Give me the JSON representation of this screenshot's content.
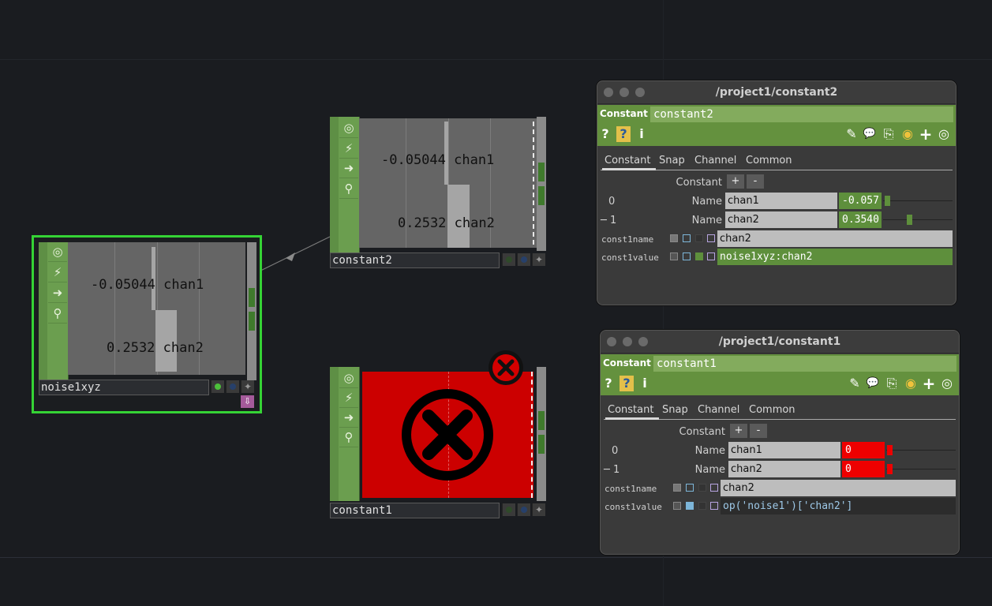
{
  "nodes": {
    "noise": {
      "name": "noise1xyz",
      "chan1_text": "-0.05044 chan1",
      "chan2_text": "0.2532 chan2"
    },
    "constant2": {
      "name": "constant2",
      "chan1_text": "-0.05044 chan1",
      "chan2_text": "0.2532 chan2"
    },
    "constant1": {
      "name": "constant1"
    }
  },
  "icons": {
    "viewer": "◎",
    "cook": "⚡",
    "export": "➜",
    "bypass": "⚲",
    "clone": "⇩",
    "error": "✕",
    "help": "?",
    "python_help": "?",
    "info": "i",
    "edit": "✎",
    "comment": "💬",
    "copy": "⎘",
    "python": "◉",
    "add": "+",
    "target": "◎"
  },
  "windows": [
    {
      "title": "/project1/constant2",
      "op_type": "Constant",
      "op_name": "constant2",
      "tabs": [
        "Constant",
        "Snap",
        "Channel",
        "Common"
      ],
      "constant_label": "Constant",
      "plus": "+",
      "minus": "-",
      "rows": [
        {
          "index": "0",
          "name_label": "Name",
          "name": "chan1",
          "value": "-0.057",
          "slider": 0.02
        },
        {
          "index": "─ 1",
          "name_label": "Name",
          "name": "chan2",
          "value": "0.3540",
          "slider": 0.35
        }
      ],
      "const1name_label": "const1name",
      "const1name_value": "chan2",
      "const1value_label": "const1value",
      "const1value_value": "noise1xyz:chan2"
    },
    {
      "title": "/project1/constant1",
      "op_type": "Constant",
      "op_name": "constant1",
      "tabs": [
        "Constant",
        "Snap",
        "Channel",
        "Common"
      ],
      "constant_label": "Constant",
      "plus": "+",
      "minus": "-",
      "rows": [
        {
          "index": "0",
          "name_label": "Name",
          "name": "chan1",
          "value": "0",
          "slider": 0.0
        },
        {
          "index": "─ 1",
          "name_label": "Name",
          "name": "chan2",
          "value": "0",
          "slider": 0.0
        }
      ],
      "const1name_label": "const1name",
      "const1name_value": "chan2",
      "const1value_label": "const1value",
      "const1value_value": "op('noise1')['chan2']"
    }
  ],
  "colors": {
    "node_green": "#6b9e4f",
    "selected": "#35d335",
    "error_red": "#cc0000",
    "value_green": "#5e8f3c"
  }
}
